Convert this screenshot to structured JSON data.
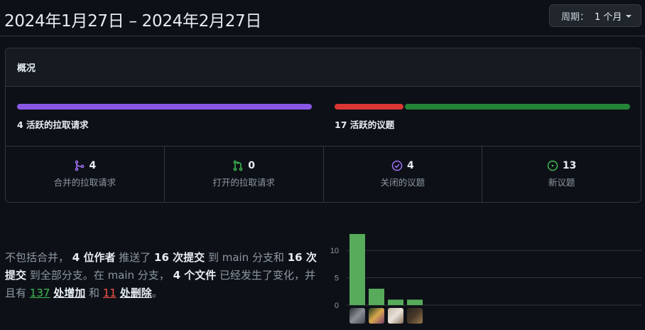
{
  "header": {
    "date_range": "2024年1月27日 – 2024年2月27日",
    "period_prefix": "周期：",
    "period_value": "1 个月"
  },
  "overview": {
    "title": "概况",
    "pr_bar_label": "4 活跃的拉取请求",
    "issue_bar_label": "17 活跃的议题",
    "issue_bar": {
      "closed_fraction": 0.235,
      "open_fraction": 0.765,
      "closed_color": "#da3633",
      "open_color": "#238636"
    },
    "pr_bar_color": "#8957e5",
    "stats": [
      {
        "icon": "merged-pr-icon",
        "count": "4",
        "label": "合并的拉取请求",
        "color": "#a371f7"
      },
      {
        "icon": "open-pr-icon",
        "count": "0",
        "label": "打开的拉取请求",
        "color": "#3fb950"
      },
      {
        "icon": "closed-issue-icon",
        "count": "4",
        "label": "关闭的议题",
        "color": "#a371f7"
      },
      {
        "icon": "new-issue-icon",
        "count": "13",
        "label": "新议题",
        "color": "#3fb950"
      }
    ]
  },
  "summary": {
    "p1": "不包括合并，",
    "authors": "4 位作者",
    "p2": "推送了",
    "commits_main": "16 次提交",
    "p3": "到 main 分支和",
    "commits_all": "16 次提交",
    "p4": "到全部分支。在 main 分支，",
    "files": "4 个文件",
    "p5": "已经发生了变化，并且有",
    "additions": "137",
    "additions_label": "处增加",
    "p6": "和",
    "deletions": "11",
    "deletions_label": "处删除",
    "p7": "。"
  },
  "chart_data": {
    "type": "bar",
    "categories": [
      "contributor-1",
      "contributor-2",
      "contributor-3",
      "contributor-4"
    ],
    "values": [
      13,
      3,
      1,
      1
    ],
    "yticks": [
      "0",
      "5",
      "10"
    ],
    "ylim": [
      0,
      13
    ],
    "bar_color": "#57ab5a"
  }
}
